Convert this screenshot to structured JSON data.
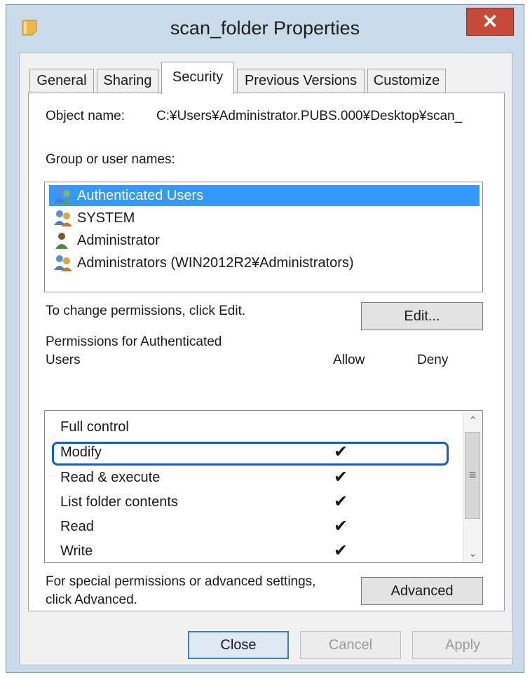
{
  "window": {
    "title": "scan_folder Properties",
    "close_glyph": "✕"
  },
  "tabs": [
    {
      "label": "General",
      "active": false
    },
    {
      "label": "Sharing",
      "active": false
    },
    {
      "label": "Security",
      "active": true
    },
    {
      "label": "Previous Versions",
      "active": false
    },
    {
      "label": "Customize",
      "active": false
    }
  ],
  "security": {
    "object_name_label": "Object name:",
    "object_name_value": "C:¥Users¥Administrator.PUBS.000¥Desktop¥scan_",
    "group_label": "Group or user names:",
    "users": [
      {
        "name": "Authenticated Users",
        "icon": "users-group-icon",
        "selected": true
      },
      {
        "name": "SYSTEM",
        "icon": "users-group-icon",
        "selected": false
      },
      {
        "name": "Administrator",
        "icon": "user-icon",
        "selected": false
      },
      {
        "name": "Administrators (WIN2012R2¥Administrators)",
        "icon": "users-group-icon",
        "selected": false
      }
    ],
    "change_perms_text": "To change permissions, click Edit.",
    "edit_button": "Edit...",
    "permissions_label_line1": "Permissions for Authenticated",
    "permissions_label_line2": "Users",
    "allow_header": "Allow",
    "deny_header": "Deny",
    "permissions": [
      {
        "name": "Full control",
        "allow": "",
        "deny": ""
      },
      {
        "name": "Modify",
        "allow": "✔",
        "deny": ""
      },
      {
        "name": "Read & execute",
        "allow": "✔",
        "deny": ""
      },
      {
        "name": "List folder contents",
        "allow": "✔",
        "deny": ""
      },
      {
        "name": "Read",
        "allow": "✔",
        "deny": ""
      },
      {
        "name": "Write",
        "allow": "✔",
        "deny": ""
      }
    ],
    "advanced_text_line1": "For special permissions or advanced settings,",
    "advanced_text_line2": "click Advanced.",
    "advanced_button": "Advanced"
  },
  "footer": {
    "close_button": "Close",
    "cancel_button": "Cancel",
    "apply_button": "Apply"
  },
  "colors": {
    "selection": "#3399ff",
    "highlight_outline": "#0b5fd3",
    "close_red": "#c7493a",
    "title_bar": "#c9dbeb"
  }
}
